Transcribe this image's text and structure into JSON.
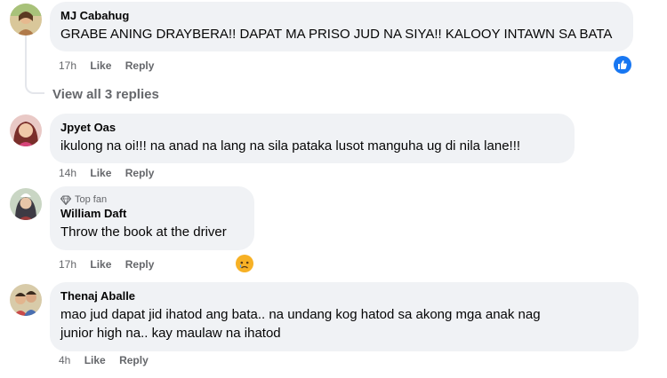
{
  "comments": [
    {
      "author": "MJ Cabahug",
      "text": "GRABE ANING DRAYBERA!! DAPAT MA PRISO JUD NA SIYA!! KALOOY INTAWN SA BATA",
      "time": "17h",
      "like_label": "Like",
      "reply_label": "Reply",
      "reaction": "like-reaction-icon",
      "view_replies": "View all 3 replies"
    },
    {
      "author": "Jpyet Oas",
      "text": "ikulong na oi!!! na anad na lang na sila pataka lusot manguha ug di nila lane!!!",
      "time": "14h",
      "like_label": "Like",
      "reply_label": "Reply"
    },
    {
      "badge": "Top fan",
      "author": "William Daft",
      "text": "Throw the book at the driver",
      "time": "17h",
      "like_label": "Like",
      "reply_label": "Reply",
      "reaction": "sad-reaction-icon"
    },
    {
      "author": "Thenaj Aballe",
      "text_line1": "mao jud dapat jid ihatod ang bata.. na undang kog hatod sa akong mga anak nag",
      "text_line2": "junior high na.. kay maulaw na ihatod",
      "time": "4h",
      "like_label": "Like",
      "reply_label": "Reply"
    }
  ],
  "colors": {
    "bubble": "#f0f2f5",
    "muted": "#65676b",
    "like_blue": "#1877f2",
    "sad_yellow": "#f7b125"
  }
}
